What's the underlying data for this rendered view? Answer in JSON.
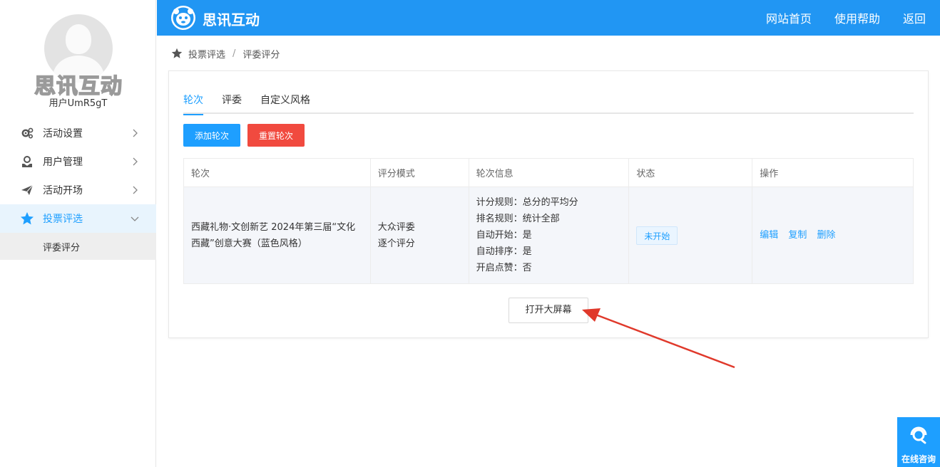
{
  "sidebar": {
    "avatar_text": "思讯互动",
    "username": "用户UmR5gT",
    "menu": [
      {
        "label": "活动设置",
        "icon": "gear-icon"
      },
      {
        "label": "用户管理",
        "icon": "user-icon"
      },
      {
        "label": "活动开场",
        "icon": "paper-plane-icon"
      },
      {
        "label": "投票评选",
        "icon": "star-icon"
      }
    ],
    "submenu": [
      {
        "label": "评委评分"
      }
    ]
  },
  "header": {
    "brand": "思讯互动",
    "nav": [
      "网站首页",
      "使用帮助",
      "返回"
    ]
  },
  "breadcrumb": [
    "投票评选",
    "评委评分"
  ],
  "tabs": [
    "轮次",
    "评委",
    "自定义风格"
  ],
  "actions": {
    "add": "添加轮次",
    "reset": "重置轮次"
  },
  "table": {
    "headers": [
      "轮次",
      "评分模式",
      "轮次信息",
      "状态",
      "操作"
    ],
    "rows": [
      {
        "round": "西藏礼物·文创新艺 2024年第三届“文化西藏”创意大赛（蓝色风格）",
        "mode": [
          "大众评委",
          "逐个评分"
        ],
        "info": [
          "计分规则：总分的平均分",
          "排名规则：统计全部",
          "自动开始：是",
          "自动排序：是",
          "开启点赞：否"
        ],
        "status": "未开始",
        "ops": [
          "编辑",
          "复制",
          "删除"
        ]
      }
    ]
  },
  "bigscreen_label": "打开大屏幕",
  "consult_label": "在线咨询",
  "colors": {
    "primary": "#2196f3",
    "danger": "#f14a3f",
    "arrow": "#e0392b"
  }
}
